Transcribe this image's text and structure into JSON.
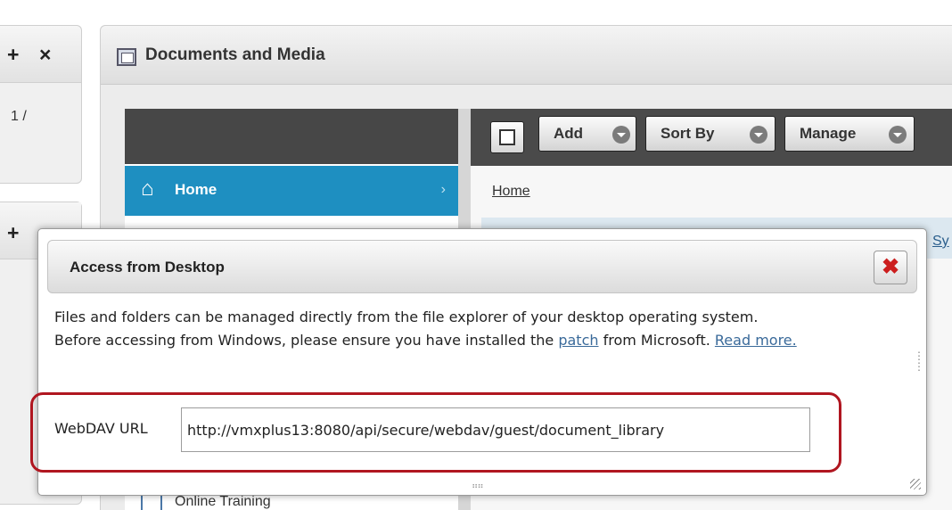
{
  "left_portlet": {
    "controls": [
      "+",
      "×"
    ],
    "text": "1 /"
  },
  "left_portlet2": {
    "controls": [
      "+"
    ]
  },
  "portlet": {
    "title": "Documents and Media"
  },
  "nav": {
    "home_label": "Home",
    "footer_label": "Online Training"
  },
  "toolbar": {
    "add_label": "Add",
    "sort_label": "Sort By",
    "manage_label": "Manage"
  },
  "breadcrumb": "Home",
  "row_text": "Sy",
  "dialog": {
    "title": "Access from Desktop",
    "close_glyph": "✖",
    "body_line1": "Files and folders can be managed directly from the file explorer of your desktop operating system.",
    "body_line2_before": "Before accessing from Windows, please ensure you have installed the ",
    "patch_link": "patch",
    "body_line2_after": " from Microsoft. ",
    "read_more_link": "Read more.",
    "webdav_label": "WebDAV URL",
    "webdav_url": "http://vmxplus13:8080/api/secure/webdav/guest/document_library"
  },
  "colors": {
    "nav_active": "#1e8fc1",
    "toolbar": "#4a4a4a",
    "highlight": "#b01620",
    "close": "#cc1e1e"
  }
}
